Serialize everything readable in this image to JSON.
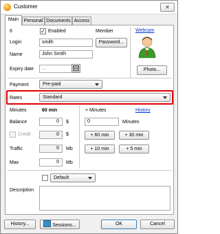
{
  "window": {
    "title": "Customer",
    "close_glyph": "✕"
  },
  "tabs": [
    {
      "label": "Main",
      "active": true
    },
    {
      "label": "Personal",
      "active": false
    },
    {
      "label": "Documents",
      "active": false
    },
    {
      "label": "Access",
      "active": false
    }
  ],
  "account": {
    "id": "6",
    "enabled_label": "Enabled",
    "enabled_checked": true,
    "member_label": "Member",
    "login_label": "Login",
    "login_value": "smith",
    "password_button": "Password...",
    "name_label": "Name",
    "name_value": "John Smith",
    "expiry_label": "Expiry date",
    "expiry_value": ". .",
    "webcam_link": "Webcam",
    "photo_button": "Photo...",
    "avatar_icon": "user-avatar-icon",
    "calendar_icon": "calendar-icon"
  },
  "payment": {
    "label": "Payment",
    "value": "Pre-paid"
  },
  "rates": {
    "label": "Rates",
    "value": "Standard"
  },
  "balance_section": {
    "minutes_label": "Minutes",
    "minutes_value": "60 min",
    "balance_label": "Balance",
    "balance_value": "0",
    "credit_label": "Credit",
    "credit_value": "0",
    "traffic_label": "Traffic",
    "traffic_value": "0",
    "max_label": "Max",
    "max_value": "0",
    "currency": "$",
    "traffic_unit": "Mb"
  },
  "add_minutes": {
    "label": "+ Minutes",
    "history_link": "History",
    "input_value": "0",
    "minutes_unit": "Minutes",
    "buttons": [
      "+ 60 min",
      "+ 30 min",
      "+ 10 min",
      "+ 5 min"
    ]
  },
  "group": {
    "value": "Default",
    "checked": false
  },
  "description": {
    "label": "Description",
    "value": ""
  },
  "footer": {
    "history_button": "History...",
    "sessions_button": "Sessions...",
    "ok_button": "OK",
    "cancel_button": "Cancel"
  },
  "colors": {
    "highlight": "#e00000",
    "link": "#0033cc"
  }
}
